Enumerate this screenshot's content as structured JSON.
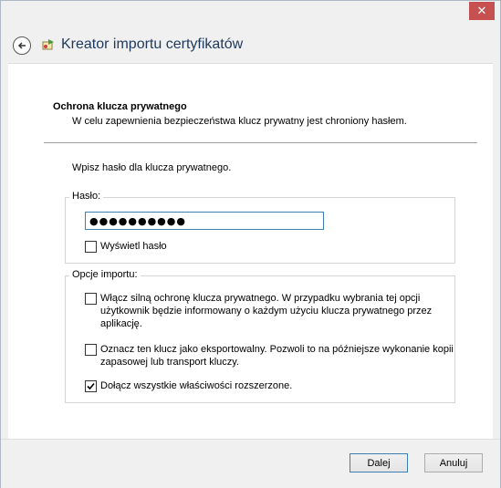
{
  "window": {
    "close_glyph": "✕"
  },
  "header": {
    "title": "Kreator importu certyfikatów",
    "back_icon": "back-arrow-icon",
    "wizard_icon": "certificate-wizard-icon"
  },
  "section": {
    "title": "Ochrona klucza prywatnego",
    "description": "W celu zapewnienia bezpieczeństwa klucz prywatny jest chroniony hasłem."
  },
  "prompt": "Wpisz hasło dla klucza prywatnego.",
  "password_group": {
    "legend": "Hasło:",
    "value": "●●●●●●●●●●",
    "show_password_label": "Wyświetl hasło",
    "show_password_checked": false
  },
  "import_group": {
    "legend": "Opcje importu:",
    "options": [
      {
        "label": "Włącz silną ochronę klucza prywatnego. W przypadku wybrania tej opcji\nużytkownik będzie informowany o każdym użyciu klucza prywatnego przez\naplikację.",
        "checked": false
      },
      {
        "label": "Oznacz ten klucz jako eksportowalny. Pozwoli to na późniejsze wykonanie kopii\nzapasowej lub transport kluczy.",
        "checked": false
      },
      {
        "label": "Dołącz wszystkie właściwości rozszerzone.",
        "checked": true
      }
    ]
  },
  "footer": {
    "next_label": "Dalej",
    "cancel_label": "Anuluj"
  },
  "colors": {
    "close": "#c75050",
    "title_text": "#1e395b",
    "focus_border": "#3c7fb1"
  }
}
